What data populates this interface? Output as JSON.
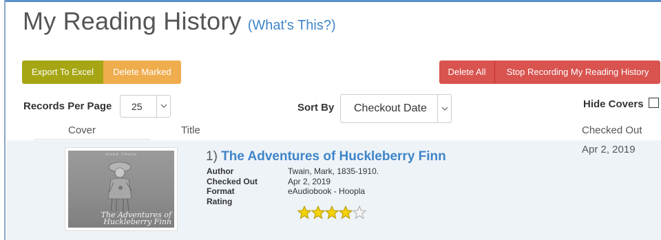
{
  "header": {
    "title": "My Reading History",
    "whats_this": "(What's This?)"
  },
  "toolbar": {
    "export_label": "Export To Excel",
    "delete_marked_label": "Delete Marked",
    "delete_all_label": "Delete All",
    "stop_recording_label": "Stop Recording My Reading History",
    "colors": {
      "export": "#a6a614",
      "delete_marked": "#f0ad4e",
      "danger": "#d9534f"
    }
  },
  "controls": {
    "records_per_page_label": "Records Per Page",
    "records_per_page_value": "25",
    "sort_by_label": "Sort By",
    "sort_by_value": "Checkout Date",
    "hide_covers_label": "Hide Covers",
    "hide_covers_checked": false
  },
  "columns": {
    "cover": "Cover",
    "title": "Title",
    "checked_out": "Checked Out"
  },
  "items": [
    {
      "number": "1)",
      "title": "The Adventures of Huckleberry Finn",
      "checked_out_column": "Apr 2, 2019",
      "cover": {
        "author_text": "MARK TWAIN",
        "title_line1": "The Adventures of",
        "title_line2": "Huckleberry Finn"
      },
      "meta": [
        {
          "key": "Author",
          "value": "Twain, Mark, 1835-1910."
        },
        {
          "key": "Checked Out",
          "value": "Apr 2, 2019"
        },
        {
          "key": "Format",
          "value": "eAudiobook - Hoopla"
        },
        {
          "key": "Rating",
          "value": ""
        }
      ],
      "rating": 4,
      "rating_max": 5
    }
  ]
}
